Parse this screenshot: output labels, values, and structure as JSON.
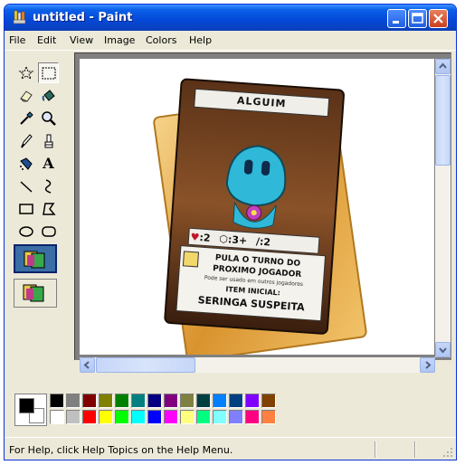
{
  "window": {
    "title": "untitled - Paint",
    "colors": {
      "titlebar": "#0A5FE8",
      "face": "#ECE9D8",
      "close": "#C8401E"
    }
  },
  "menubar": {
    "items": [
      {
        "label": "File"
      },
      {
        "label": "Edit"
      },
      {
        "label": "View"
      },
      {
        "label": "Image"
      },
      {
        "label": "Colors"
      },
      {
        "label": "Help"
      }
    ]
  },
  "toolbox": {
    "tools": [
      {
        "name": "free-form-select",
        "icon": "star-select-icon"
      },
      {
        "name": "select",
        "icon": "rect-select-icon",
        "selected": true
      },
      {
        "name": "eraser",
        "icon": "eraser-icon"
      },
      {
        "name": "fill",
        "icon": "fill-bucket-icon"
      },
      {
        "name": "pick-color",
        "icon": "eyedropper-icon"
      },
      {
        "name": "magnifier",
        "icon": "magnifier-icon"
      },
      {
        "name": "pencil",
        "icon": "pencil-icon"
      },
      {
        "name": "brush",
        "icon": "brush-icon"
      },
      {
        "name": "airbrush",
        "icon": "airbrush-icon"
      },
      {
        "name": "text",
        "icon": "text-icon",
        "glyph": "A"
      },
      {
        "name": "line",
        "icon": "line-icon"
      },
      {
        "name": "curve",
        "icon": "curve-icon"
      },
      {
        "name": "rectangle",
        "icon": "rectangle-icon"
      },
      {
        "name": "polygon",
        "icon": "polygon-icon"
      },
      {
        "name": "ellipse",
        "icon": "ellipse-icon"
      },
      {
        "name": "rounded-rectangle",
        "icon": "rounded-rect-icon"
      }
    ]
  },
  "canvas": {
    "card": {
      "title": "ALGUIM",
      "stats": {
        "hearts": ":2",
        "dice": ":3+",
        "sword": ":2"
      },
      "ability_line1": "PULA O TURNO DO",
      "ability_line2": "PROXIMO JOGADOR",
      "note": "Pode ser usado em outros jogadores",
      "item_label": "ITEM INICIAL:",
      "item_name": "SERINGA SUSPEITA"
    }
  },
  "palette": {
    "foreground": "#000000",
    "background": "#FFFFFF",
    "row1": [
      "#000000",
      "#808080",
      "#800000",
      "#808000",
      "#008000",
      "#008080",
      "#000080",
      "#800080",
      "#808040",
      "#004040",
      "#0080FF",
      "#004080",
      "#8000FF",
      "#804000"
    ],
    "row2": [
      "#FFFFFF",
      "#C0C0C0",
      "#FF0000",
      "#FFFF00",
      "#00FF00",
      "#00FFFF",
      "#0000FF",
      "#FF00FF",
      "#FFFF80",
      "#00FF80",
      "#80FFFF",
      "#8080FF",
      "#FF0080",
      "#FF8040"
    ]
  },
  "statusbar": {
    "text": "For Help, click Help Topics on the Help Menu."
  }
}
